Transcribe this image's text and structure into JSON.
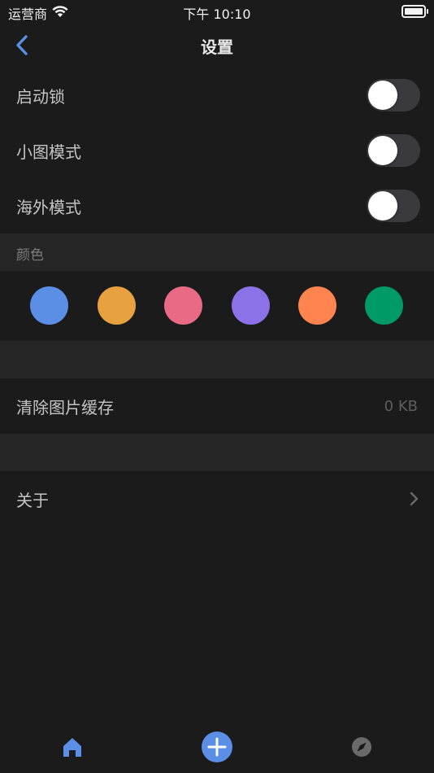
{
  "status_bar": {
    "carrier": "运营商",
    "time": "下午 10:10"
  },
  "nav": {
    "title": "设置"
  },
  "toggles": [
    {
      "label": "启动锁",
      "on": false
    },
    {
      "label": "小图模式",
      "on": false
    },
    {
      "label": "海外模式",
      "on": false
    }
  ],
  "color_section": {
    "header": "颜色",
    "swatches": [
      "#5b8fe6",
      "#e8a13f",
      "#e86a84",
      "#8b72e6",
      "#ff8450",
      "#009a66"
    ]
  },
  "cache": {
    "label": "清除图片缓存",
    "value": "0 KB"
  },
  "about": {
    "label": "关于"
  },
  "accent_color": "#5b8fe6",
  "tab_bar": {
    "tabs": [
      "home-icon",
      "add-icon",
      "compass-icon"
    ]
  }
}
